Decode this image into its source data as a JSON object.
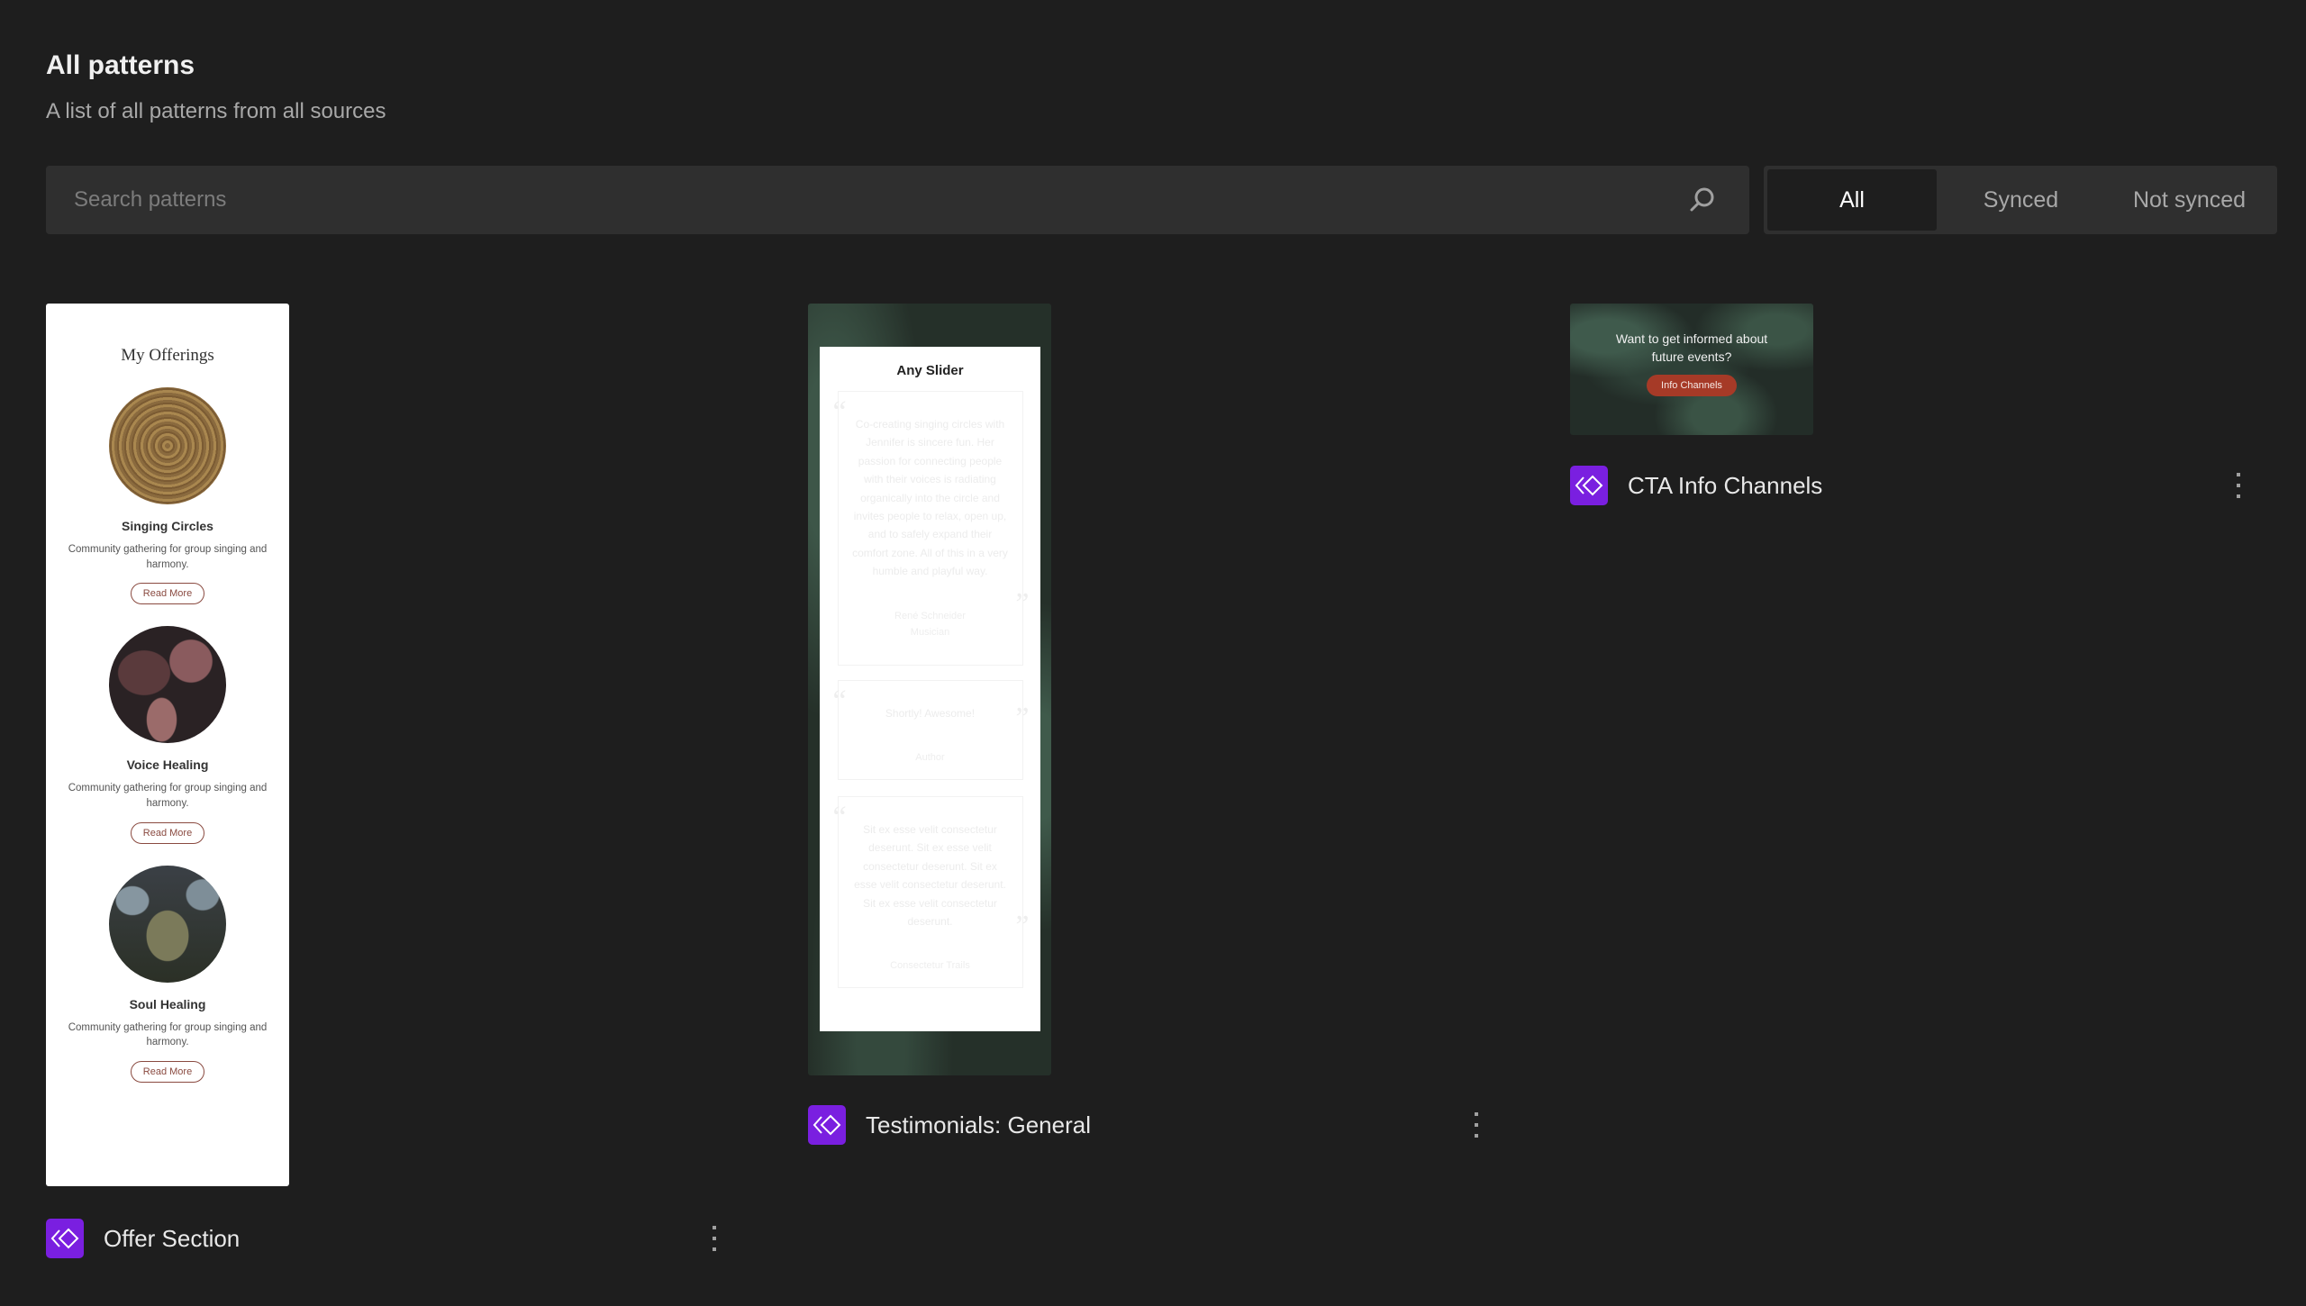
{
  "header": {
    "title": "All patterns",
    "subtitle": "A list of all patterns from all sources"
  },
  "search": {
    "placeholder": "Search patterns",
    "value": "",
    "icon": "search-icon"
  },
  "filter": {
    "options": [
      "All",
      "Synced",
      "Not synced"
    ],
    "selected": "All"
  },
  "colors": {
    "background": "#1e1e1e",
    "surface": "#2f2f2f",
    "pattern_icon": "#7a1fe0",
    "cta_button": "#a63a27",
    "read_more": "#8a4a40"
  },
  "patterns": [
    {
      "title": "Offer Section",
      "icon": "pattern-icon",
      "menu_icon": "more-vertical-icon",
      "preview": {
        "heading": "My Offerings",
        "items": [
          {
            "name": "Singing Circles",
            "description": "Community gathering for group singing and harmony.",
            "button": "Read More"
          },
          {
            "name": "Voice Healing",
            "description": "Community gathering for group singing and harmony.",
            "button": "Read More"
          },
          {
            "name": "Soul Healing",
            "description": "Community gathering for group singing and harmony.",
            "button": "Read More"
          }
        ]
      }
    },
    {
      "title": "Testimonials: General",
      "icon": "pattern-icon",
      "menu_icon": "more-vertical-icon",
      "preview": {
        "heading": "Any Slider",
        "testimonials": [
          {
            "quote": "Co-creating singing circles with Jennifer is sincere fun. Her passion for connecting people with their voices is radiating organically into the circle and invites people to relax, open up, and to safely expand their comfort zone. All of this in a very humble and playful way.",
            "author": "René Schneider",
            "role": "Musician"
          },
          {
            "quote": "Shortly! Awesome!",
            "author": "Author",
            "role": ""
          },
          {
            "quote": "Sit ex esse velit consectetur deserunt. Sit ex esse velit consectetur deserunt. Sit ex esse velit consectetur deserunt. Sit ex esse velit consectetur deserunt.",
            "author": "Consectetur Trails",
            "role": ""
          }
        ]
      }
    },
    {
      "title": "CTA Info Channels",
      "icon": "pattern-icon",
      "menu_icon": "more-vertical-icon",
      "preview": {
        "text": "Want to get informed about future events?",
        "button": "Info Channels"
      }
    }
  ]
}
